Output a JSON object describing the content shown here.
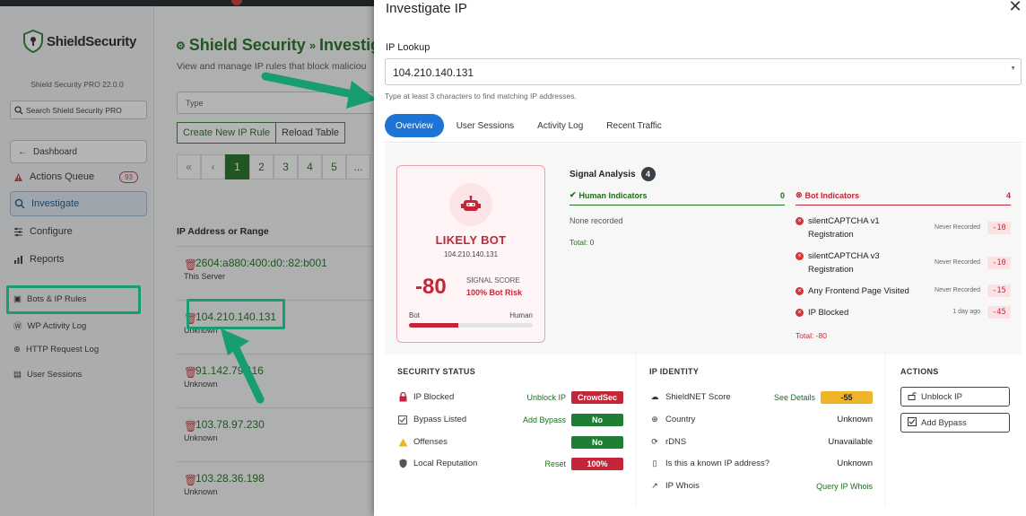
{
  "sidebar": {
    "logo_text": "ShieldSecurity",
    "version": "Shield Security PRO 22.0.0",
    "search_placeholder": "Search Shield Security PRO",
    "dashboard": "Dashboard",
    "nav": [
      {
        "label": "Actions Queue",
        "badge": "93"
      },
      {
        "label": "Investigate"
      },
      {
        "label": "Configure"
      },
      {
        "label": "Reports"
      }
    ],
    "subnav": [
      "Bots & IP Rules",
      "WP Activity Log",
      "HTTP Request Log",
      "User Sessions"
    ]
  },
  "main": {
    "title_prefix": "Shield Security",
    "title_sep": "»",
    "title_suffix": "Investig",
    "subtitle": "View and manage IP rules that block maliciou",
    "type_placeholder": "Type",
    "buttons": [
      "Create New IP Rule",
      "Reload Table"
    ],
    "pager": [
      "«",
      "‹",
      "1",
      "2",
      "3",
      "4",
      "5",
      "..."
    ],
    "column_header": "IP Address or Range",
    "rows": [
      {
        "ip": "2604:a880:400:d0::82:b001",
        "note": "This Server"
      },
      {
        "ip": "104.210.140.131",
        "note": "Unknown"
      },
      {
        "ip": "91.142.79.116",
        "note": "Unknown"
      },
      {
        "ip": "103.78.97.230",
        "note": "Unknown"
      },
      {
        "ip": "103.28.36.198",
        "note": "Unknown"
      }
    ]
  },
  "panel": {
    "title": "Investigate IP",
    "lookup_label": "IP Lookup",
    "lookup_value": "104.210.140.131",
    "hint": "Type at least 3 characters to find matching IP addresses.",
    "tabs": [
      "Overview",
      "User Sessions",
      "Activity Log",
      "Recent Traffic"
    ],
    "verdict": {
      "label": "LIKELY BOT",
      "ip": "104.210.140.131",
      "score": "-80",
      "score_label": "SIGNAL SCORE",
      "risk": "100% Bot Risk",
      "bar_left": "Bot",
      "bar_right": "Human",
      "bot_fraction": 0.4
    },
    "signal": {
      "title": "Signal Analysis",
      "count": "4",
      "human_header": "Human Indicators",
      "human_count": "0",
      "human_none": "None recorded",
      "human_total": "Total: 0",
      "bot_header": "Bot Indicators",
      "bot_count": "4",
      "bot_items": [
        {
          "text": "silentCAPTCHA v1 Registration",
          "when": "Never Recorded",
          "value": "-10"
        },
        {
          "text": "silentCAPTCHA v3 Registration",
          "when": "Never Recorded",
          "value": "-10"
        },
        {
          "text": "Any Frontend Page Visited",
          "when": "Never Recorded",
          "value": "-15"
        },
        {
          "text": "IP Blocked",
          "when": "1 day ago",
          "value": "-45"
        }
      ],
      "bot_total": "Total: -80"
    },
    "security_status": {
      "title": "SECURITY STATUS",
      "rows": [
        {
          "label": "IP Blocked",
          "link": "Unblock IP",
          "pill": "CrowdSec",
          "color": "#c32638"
        },
        {
          "label": "Bypass Listed",
          "link": "Add Bypass",
          "pill": "No",
          "color": "#1e7e34"
        },
        {
          "label": "Offenses",
          "link": "",
          "pill": "No",
          "color": "#1e7e34"
        },
        {
          "label": "Local Reputation",
          "link": "Reset",
          "pill": "100%",
          "color": "#c32638"
        }
      ]
    },
    "ip_identity": {
      "title": "IP IDENTITY",
      "rows": [
        {
          "label": "ShieldNET Score",
          "link": "See Details",
          "value": "-55"
        },
        {
          "label": "Country",
          "value": "Unknown"
        },
        {
          "label": "rDNS",
          "value": "Unavailable"
        },
        {
          "label": "Is this a known IP address?",
          "value": "Unknown"
        },
        {
          "label": "IP Whois",
          "link": "Query IP Whois"
        }
      ]
    },
    "actions": {
      "title": "ACTIONS",
      "buttons": [
        "Unblock IP",
        "Add Bypass"
      ]
    }
  }
}
